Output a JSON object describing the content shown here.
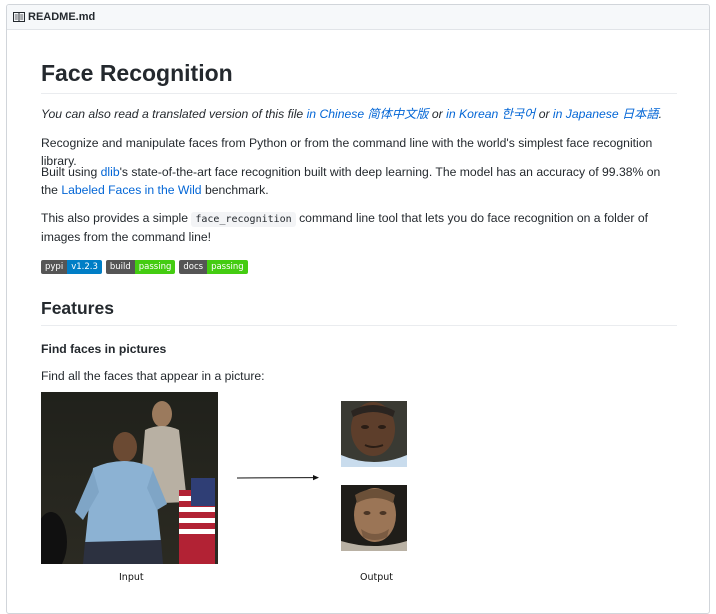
{
  "file_header": {
    "icon": "book-icon",
    "filename": "README.md"
  },
  "readme": {
    "title": "Face Recognition",
    "translated_line": {
      "prefix": "You can also read a translated version of this file ",
      "link_chinese": "in Chinese 简体中文版",
      "or1": " or ",
      "link_korean": "in Korean 한국어",
      "or2": " or ",
      "link_japanese": "in Japanese 日本語",
      "suffix": "."
    },
    "intro": "Recognize and manipulate faces from Python or from the command line with the world's simplest face recognition library.",
    "built_using": {
      "prefix": "Built using ",
      "link_dlib": "dlib",
      "middle": "'s state-of-the-art face recognition built with deep learning. The model has an accuracy of 99.38% on the ",
      "link_lfw": "Labeled Faces in the Wild",
      "suffix": " benchmark."
    },
    "cli_line": {
      "prefix": "This also provides a simple ",
      "code": "face_recognition",
      "suffix": " command line tool that lets you do face recognition on a folder of images from the command line!"
    },
    "badges": [
      {
        "label": "pypi",
        "value": "v1.2.3",
        "color": "#007ec6"
      },
      {
        "label": "build",
        "value": "passing",
        "color": "#4c1"
      },
      {
        "label": "docs",
        "value": "passing",
        "color": "#4c1"
      }
    ],
    "features_heading": "Features",
    "find_faces_heading": "Find faces in pictures",
    "find_faces_text": "Find all the faces that appear in a picture:",
    "figure": {
      "input_label": "Input",
      "output_label": "Output"
    }
  }
}
